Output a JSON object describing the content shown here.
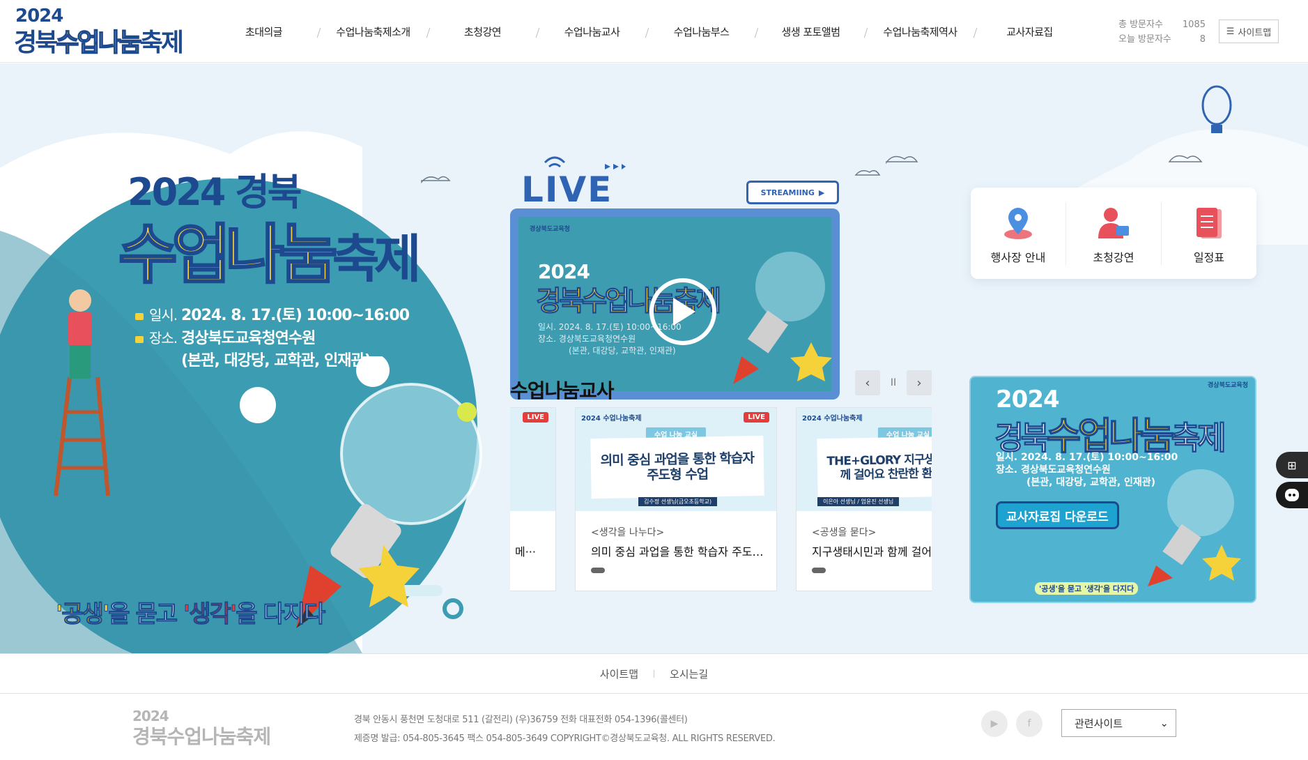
{
  "header": {
    "logo_year": "2024",
    "logo_name_a": "경북",
    "logo_name_b": "수업나눔",
    "logo_name_c": "축제",
    "nav": [
      "초대의글",
      "수업나눔축제소개",
      "초청강연",
      "수업나눔교사",
      "수업나눔부스",
      "생생 포토앨범",
      "수업나눔축제역사",
      "교사자료집"
    ],
    "visit_total_label": "총 방문자수",
    "visit_total_value": "1085",
    "visit_today_label": "오늘 방문자수",
    "visit_today_value": "8",
    "sitemap_label": "사이트맵"
  },
  "poster": {
    "title_line1": "2024 경북",
    "title_a": "수업나눔",
    "title_b": "축제",
    "date_label": "일시.",
    "date_value": "2024. 8. 17.(토) 10:00~16:00",
    "place_label": "장소.",
    "place_value": "경상북도교육청연수원",
    "place_detail": "(본관, 대강당, 교학관, 인재관)",
    "slogan_a": "'공생'",
    "slogan_b": "을 묻고",
    "slogan_c": "'생각'",
    "slogan_d": "을 다지다"
  },
  "live": {
    "label": "LIVE",
    "streaming_label": "STREAMIING",
    "video_org": "경상북도교육청",
    "video_year": "2024",
    "video_title": "경북수업나눔축제",
    "video_date": "일시.  2024. 8. 17.(토) 10:00~16:00",
    "video_place": "장소.  경상북도교육청연수원",
    "video_place_detail": "(본관, 대강당, 교학관, 인재관)"
  },
  "quick_links": [
    {
      "label": "행사장 안내",
      "icon": "location-pin-icon",
      "color": "#4a8fe0"
    },
    {
      "label": "초청강연",
      "icon": "person-lecture-icon",
      "color": "#e8505b"
    },
    {
      "label": "일정표",
      "icon": "document-list-icon",
      "color": "#e8505b"
    }
  ],
  "teacher_section": {
    "title": "수업나눔교사",
    "prev": "‹",
    "pause": "II",
    "next": "›",
    "cards": [
      {
        "badge": "LIVE",
        "category": "",
        "title": "메···",
        "thumb_title": "",
        "thumb_tag": "",
        "thumb_name": ""
      },
      {
        "badge": "LIVE",
        "category": "<생각을 나누다>",
        "title": "의미 중심 과업을 통한 학습자 주도형 수업",
        "thumb_title": "의미 중심 과업을 통한 학습자 주도형 수업",
        "thumb_tag": "수업 나눔 교실",
        "thumb_name": "김수정 선생님(금오초등학교)"
      },
      {
        "badge": "",
        "category": "<공생을 묻다>",
        "title": "지구생태시민과 함께 걸어요",
        "thumb_title": "THE+GLORY 지구생태시민과 함께 걸어요 찬란한 환경 어울림",
        "thumb_tag": "수업 나눔 교실",
        "thumb_name": "이은아 선생님 / 엄윤진 선생님"
      }
    ]
  },
  "banner": {
    "org": "경상북도교육청",
    "year": "2024",
    "title_a": "경북",
    "title_b": "수업나눔",
    "title_c": "축제",
    "date": "일시.  2024. 8. 17.(토) 10:00~16:00",
    "place": "장소.  경상북도교육청연수원",
    "place_detail": "(본관, 대강당, 교학관, 인재관)",
    "download_label": "교사자료집 다운로드",
    "slogan": "'공생'을 묻고 '생각'을 다지다"
  },
  "footer": {
    "links": [
      "사이트맵",
      "오시는길"
    ],
    "logo_year": "2024",
    "logo_name": "경북수업나눔축제",
    "address": "경북 안동시 풍천면 도청대로 511 (갈전리) (우)36759 전화 대표전화 054-1396(콜센터)",
    "copyright": "제증명 발급: 054-805-3645 팩스 054-805-3649 COPYRIGHT©경상북도교육청. ALL RIGHTS RESERVED.",
    "related_sites": "관련사이트",
    "sns": [
      "youtube-icon",
      "facebook-icon"
    ]
  },
  "colors": {
    "navy": "#1d4a8f",
    "yellow": "#f6d23a",
    "teal": "#3d9cb0",
    "bg": "#eaf3fa"
  }
}
